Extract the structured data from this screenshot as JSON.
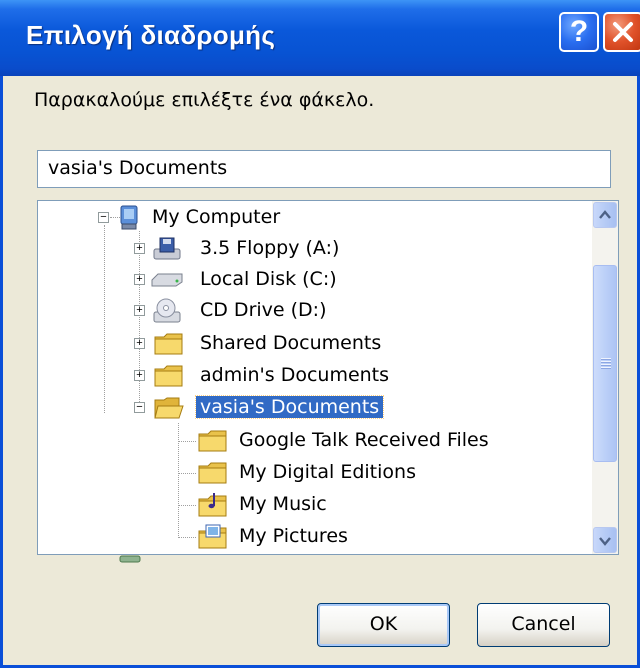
{
  "window": {
    "title": "Επιλογή διαδρομής"
  },
  "titlebar_buttons": {
    "help_label": "?"
  },
  "prompt": "Παρακαλούμε επιλέξτε ένα φάκελο.",
  "path_field": {
    "value": "vasia's Documents"
  },
  "tree": {
    "root": {
      "label": "My Computer",
      "icon": "computer-icon",
      "expanded": true
    },
    "drives": [
      {
        "label": "3.5 Floppy (A:)",
        "icon": "floppy-drive-icon"
      },
      {
        "label": "Local Disk (C:)",
        "icon": "hard-disk-icon"
      },
      {
        "label": "CD Drive (D:)",
        "icon": "cd-drive-icon"
      },
      {
        "label": "Shared Documents",
        "icon": "folder-icon"
      },
      {
        "label": "admin's Documents",
        "icon": "folder-icon"
      },
      {
        "label": "vasia's Documents",
        "icon": "open-folder-icon",
        "selected": true,
        "expanded": true
      }
    ],
    "children": [
      {
        "label": "Google Talk Received Files",
        "icon": "folder-icon"
      },
      {
        "label": "My Digital Editions",
        "icon": "folder-icon"
      },
      {
        "label": "My Music",
        "icon": "music-folder-icon"
      },
      {
        "label": "My Pictures",
        "icon": "pictures-folder-icon"
      }
    ]
  },
  "buttons": {
    "ok": "OK",
    "cancel": "Cancel"
  },
  "colors": {
    "titlebar": "#0a58da",
    "dialog_bg": "#ece9d8",
    "selection": "#316ac5",
    "close": "#e0522a"
  }
}
